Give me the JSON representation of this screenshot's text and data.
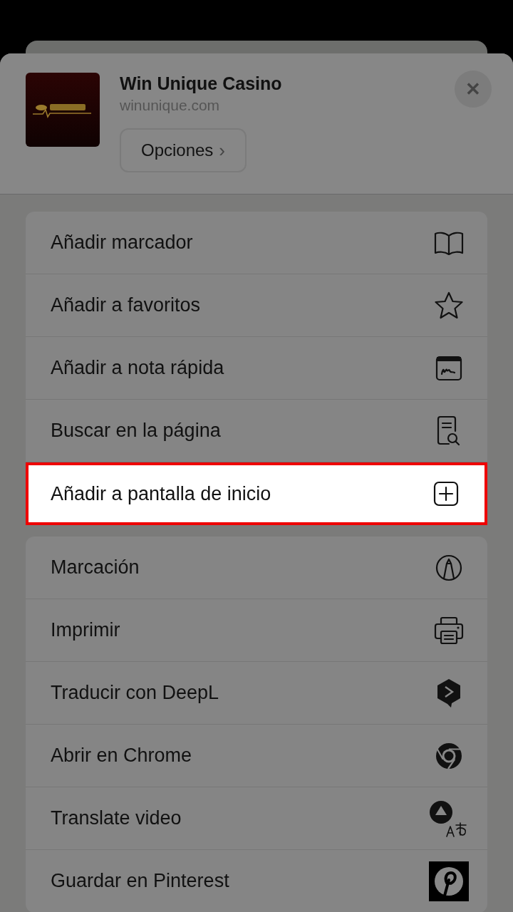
{
  "header": {
    "title": "Win Unique Casino",
    "url": "winunique.com",
    "options_button": "Opciones",
    "chevron": "›",
    "close": "✕"
  },
  "groups": [
    [
      {
        "label": "Añadir marcador",
        "highlighted": false
      },
      {
        "label": "Añadir a favoritos",
        "highlighted": false
      },
      {
        "label": "Añadir a nota rápida",
        "highlighted": false
      },
      {
        "label": "Buscar en la página",
        "highlighted": false
      },
      {
        "label": "Añadir a pantalla de inicio",
        "highlighted": true
      }
    ],
    [
      {
        "label": "Marcación",
        "highlighted": false
      },
      {
        "label": "Imprimir",
        "highlighted": false
      },
      {
        "label": "Traducir con DeepL",
        "highlighted": false
      },
      {
        "label": "Abrir en Chrome",
        "highlighted": false
      },
      {
        "label": "Translate video",
        "highlighted": false
      },
      {
        "label": "Guardar en Pinterest",
        "highlighted": false
      }
    ]
  ]
}
